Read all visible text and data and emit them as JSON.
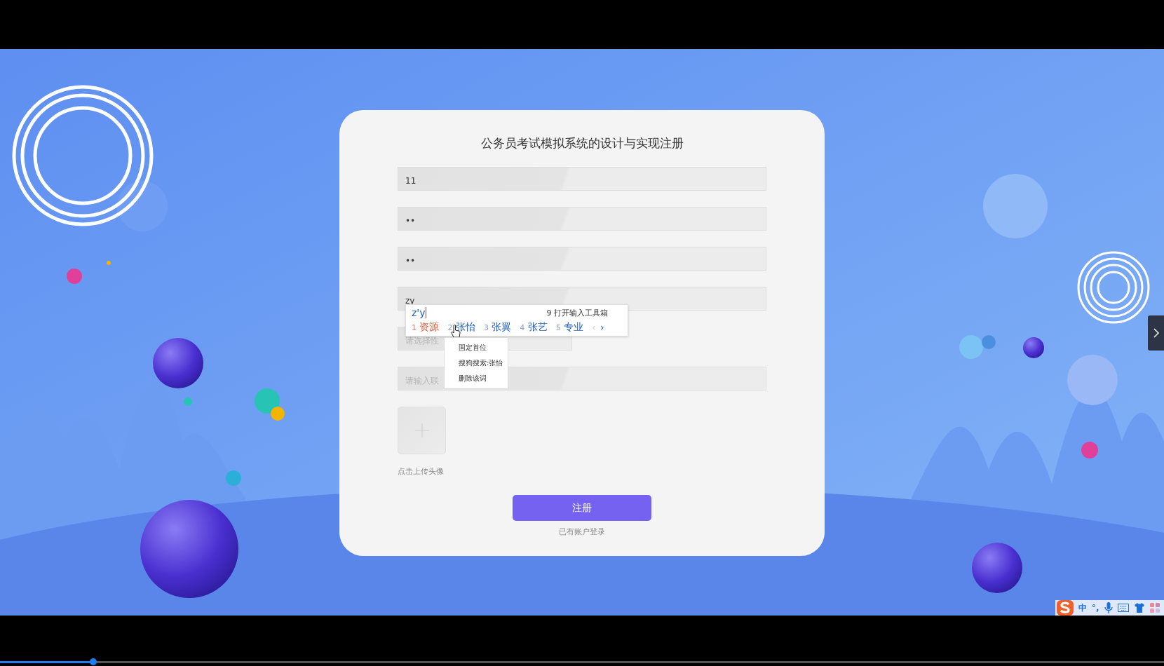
{
  "form": {
    "title": "公务员考试模拟系统的设计与实现注册",
    "fields": [
      {
        "kind": "text",
        "value": "11"
      },
      {
        "kind": "text",
        "value": "••"
      },
      {
        "kind": "text",
        "value": "••"
      },
      {
        "kind": "text",
        "value": "zy"
      },
      {
        "kind": "select",
        "placeholder": "请选择性"
      },
      {
        "kind": "text",
        "placeholder": "请输入联"
      }
    ],
    "upload_caption": "点击上传头像",
    "submit": "注册",
    "login_link": "已有账户登录"
  },
  "ime_popup": {
    "input": "z'y",
    "toolbox": "9 打开输入工具箱",
    "candidates": [
      {
        "number": "1",
        "word": "资源",
        "selected": true
      },
      {
        "number": "2",
        "word": "张怡",
        "selected": false
      },
      {
        "number": "3",
        "word": "张翼",
        "selected": false
      },
      {
        "number": "4",
        "word": "张艺",
        "selected": false
      },
      {
        "number": "5",
        "word": "专业",
        "selected": false
      }
    ],
    "prev": "‹",
    "next": "›"
  },
  "context_menu": [
    "固定首位",
    "搜狗搜索:张怡",
    "删除该词"
  ],
  "ime_toolbar": {
    "mode": "中",
    "punctuation": "°,"
  },
  "playback": {
    "level": 0.08
  }
}
